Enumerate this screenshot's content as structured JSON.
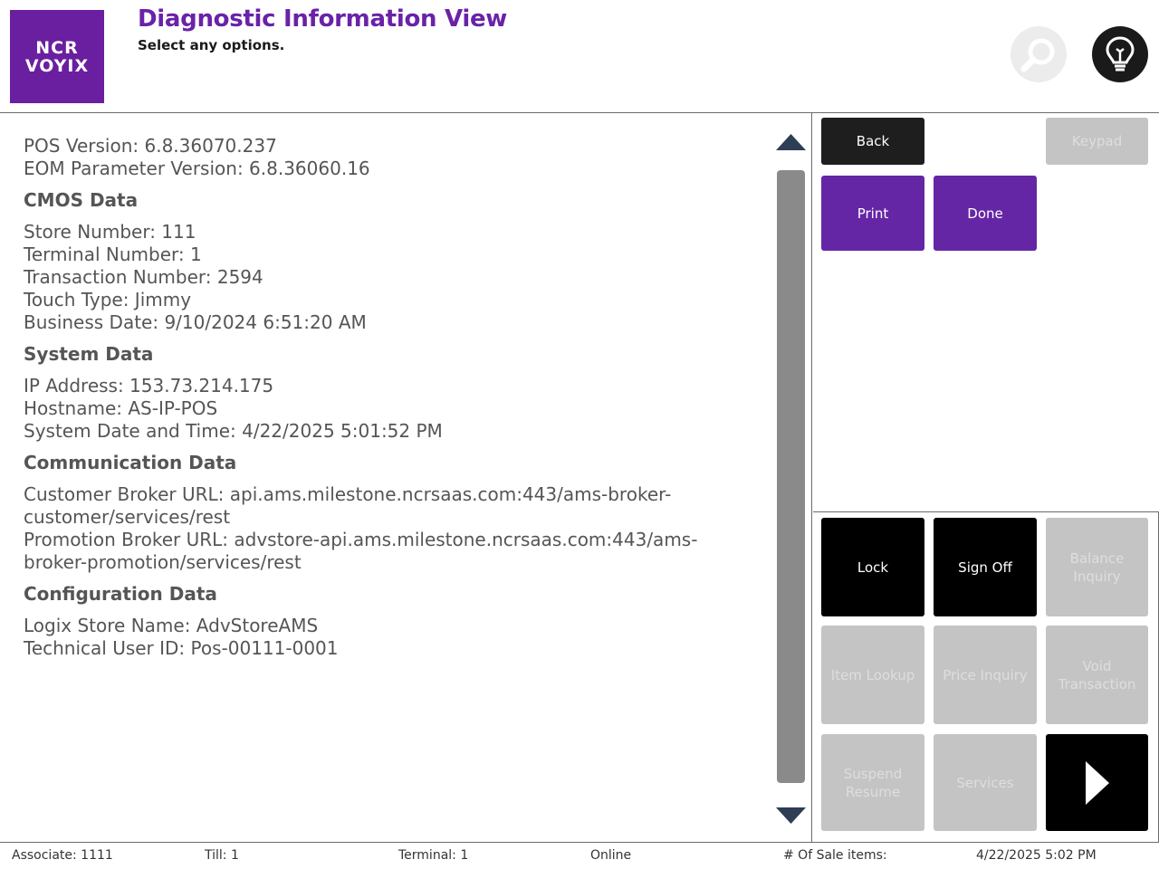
{
  "header": {
    "logo_line1": "NCR",
    "logo_line2": "VOYIX",
    "title": "Diagnostic Information View",
    "subtitle": "Select any options."
  },
  "info": {
    "pos_version": "POS Version: 6.8.36070.237",
    "eom_version": "EOM Parameter Version: 6.8.36060.16",
    "cmos_head": "CMOS Data",
    "store_number": "Store Number: 111",
    "terminal_number": "Terminal Number: 1",
    "transaction_number": "Transaction Number: 2594",
    "touch_type": "Touch Type: Jimmy",
    "business_date": "Business Date: 9/10/2024 6:51:20 AM",
    "system_head": "System Data",
    "ip_address": "IP Address: 153.73.214.175",
    "hostname": "Hostname: AS-IP-POS",
    "system_datetime": "System Date and Time: 4/22/2025 5:01:52 PM",
    "comm_head": "Communication Data",
    "customer_broker_1": "Customer Broker URL: api.ams.milestone.ncrsaas.com:443/ams-broker-",
    "customer_broker_2": "customer/services/rest",
    "promotion_broker_1": "Promotion Broker URL: advstore-api.ams.milestone.ncrsaas.com:443/ams-",
    "promotion_broker_2": "broker-promotion/services/rest",
    "config_head": "Configuration Data",
    "logix_store": "Logix Store Name: AdvStoreAMS",
    "tech_user": "Technical User ID: Pos-00111-0001"
  },
  "buttons": {
    "back": "Back",
    "keypad": "Keypad",
    "print": "Print",
    "done": "Done",
    "lock": "Lock",
    "sign_off": "Sign Off",
    "balance_inquiry_1": "Balance",
    "balance_inquiry_2": "Inquiry",
    "item_lookup": "Item Lookup",
    "price_inquiry": "Price Inquiry",
    "void_transaction_1": "Void",
    "void_transaction_2": "Transaction",
    "suspend_resume_1": "Suspend",
    "suspend_resume_2": "Resume",
    "services": "Services"
  },
  "status": {
    "associate": "Associate: 1111",
    "till": "Till: 1",
    "terminal": "Terminal: 1",
    "online": "Online",
    "sale_items": "# Of Sale items:",
    "datetime": "4/22/2025 5:02 PM"
  },
  "colors": {
    "brand_purple": "#6a1fa0",
    "title_purple": "#6a22a8",
    "button_purple": "#6526a6",
    "disabled_gray": "#c4c4c4"
  }
}
